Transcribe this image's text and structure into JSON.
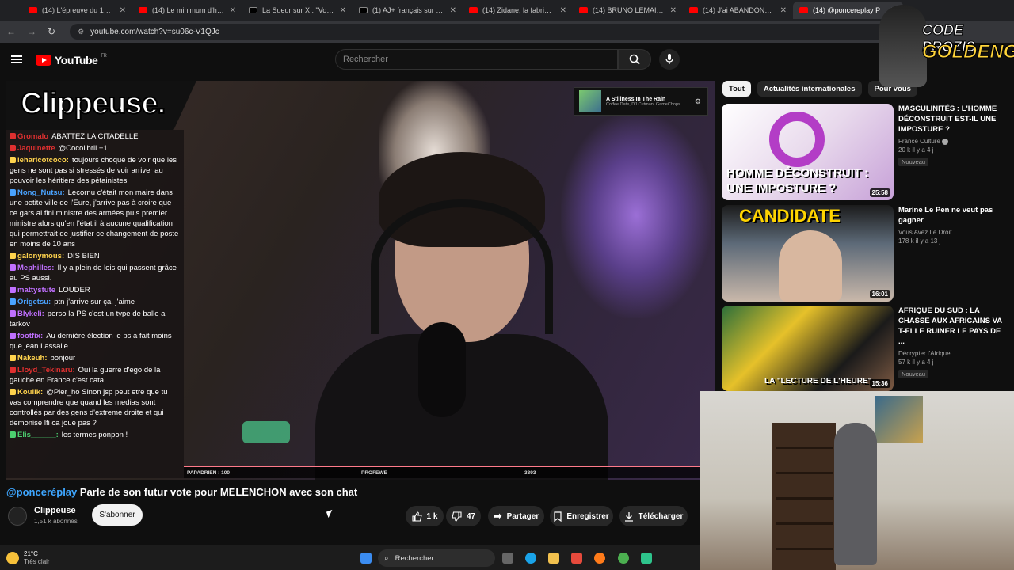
{
  "browser": {
    "tabs": [
      {
        "label": "(14) L'épreuve du 100 mi",
        "type": "youtube"
      },
      {
        "label": "(14) Le minimum d'heure",
        "type": "youtube"
      },
      {
        "label": "La Sueur sur X : \"Vous pla",
        "type": "x"
      },
      {
        "label": "(1) AJ+ français sur X : \"C",
        "type": "x"
      },
      {
        "label": "(14) Zidane, la fabrique d",
        "type": "youtube"
      },
      {
        "label": "(14) BRUNO LEMAIRE HU",
        "type": "youtube"
      },
      {
        "label": "(14) J'ai ABANDONNÉ ce",
        "type": "youtube"
      },
      {
        "label": "(14) @poncereplay P",
        "type": "youtube",
        "active": true
      }
    ],
    "url": "youtube.com/watch?v=su06c-V1QJc"
  },
  "youtube": {
    "logo_text": "YouTube",
    "logo_region": "FR",
    "search_placeholder": "Rechercher"
  },
  "stream": {
    "overlay_title": "Clippeuse.",
    "music": {
      "title": "A Stillness In The Rain",
      "artist": "Coffee Date, DJ Cutman, GameChops"
    },
    "bottom_bar": [
      "PAPADRIEN : 100",
      "PROFEWE",
      "3393"
    ],
    "chat": [
      {
        "user": "Gromalo",
        "color": "#e03030",
        "text": "ABATTEZ LA CITADELLE"
      },
      {
        "user": "Jaquinette",
        "color": "#e03030",
        "text": "@Cocolibrii +1"
      },
      {
        "user": "leharicotcoco:",
        "color": "#ffd34d",
        "text": "toujours choqué de voir que les gens ne sont pas si stressés de voir arriver au pouvoir les héritiers des pétainistes"
      },
      {
        "user": "Nong_Nutsu:",
        "color": "#4aa3ff",
        "text": "Lecornu c'était mon maire dans une petite ville de l'Eure, j'arrive pas à croire que ce gars ai fini ministre des armées puis premier ministre alors qu'en l'état il à aucune qualification qui permettrait de justifier ce changement de poste en moins de 10 ans"
      },
      {
        "user": "galonymous:",
        "color": "#ffd34d",
        "text": "DIS BIEN"
      },
      {
        "user": "Mephilles:",
        "color": "#c070ff",
        "text": "Il y a plein de lois qui passent grâce au PS aussi."
      },
      {
        "user": "mattystute",
        "color": "#c070ff",
        "text": "LOUDER"
      },
      {
        "user": "Origetsu:",
        "color": "#4aa3ff",
        "text": "ptn j'arrive sur ça, j'aime"
      },
      {
        "user": "Blykeli:",
        "color": "#c070ff",
        "text": "perso la PS c'est un type de balle a tarkov"
      },
      {
        "user": "footfix:",
        "color": "#c070ff",
        "text": "Au dernière élection le ps a fait moins que jean Lassalle"
      },
      {
        "user": "Nakeuh:",
        "color": "#ffd34d",
        "text": "bonjour"
      },
      {
        "user": "Lloyd_Tekinaru:",
        "color": "#e03030",
        "text": "Oui la guerre d'ego de la gauche en France c'est cata"
      },
      {
        "user": "Kouilk:",
        "color": "#ffd34d",
        "text": "@Pier_ho Sinon jsp peut etre que tu vas comprendre que quand les medias sont controllés par des gens d'extreme droite et qui demonise lfi ca joue pas ?"
      },
      {
        "user": "Elis______:",
        "color": "#4ccf6f",
        "text": "les termes ponpon !"
      }
    ]
  },
  "video": {
    "title_mention": "@ponceréplay",
    "title_rest": "Parle de son futur vote pour MELENCHON avec son chat",
    "channel_name": "Clippeuse",
    "channel_subs": "1,51 k abonnés",
    "subscribe_label": "S'abonner",
    "likes": "1 k",
    "dislikes": "47",
    "share_label": "Partager",
    "save_label": "Enregistrer",
    "download_label": "Télécharger"
  },
  "sidebar": {
    "chips": [
      "Tout",
      "Actualités internationales",
      "Pour vous"
    ],
    "videos": [
      {
        "title": "MASCULINITÉS : L'HOMME DÉCONSTRUIT EST-IL UNE IMPOSTURE ?",
        "channel": "France Culture",
        "meta": "20 k  il y a 4 j",
        "badge": "Nouveau",
        "duration": "25:58",
        "thumb_text": "HOMME DÉCONSTRUIT : UNE IMPOSTURE ?"
      },
      {
        "title": "Marine Le Pen ne veut pas gagner",
        "channel": "Vous Avez Le Droit",
        "meta": "178 k  il y a 13 j",
        "badge": "",
        "duration": "16:01",
        "thumb_text": "CANDIDATE"
      },
      {
        "title": "AFRIQUE DU SUD : LA CHASSE AUX AFRICAINS VA T-ELLE RUINER LE PAYS DE ...",
        "channel": "Décrypter l'Afrique",
        "meta": "57 k  il y a 4 j",
        "badge": "Nouveau",
        "duration": "15:36",
        "thumb_text": "LA \"LECTURE DE L'HEURE\""
      }
    ]
  },
  "overlay": {
    "line1": "CODE PROZIS",
    "line2": "GOLDENG"
  },
  "taskbar": {
    "temperature": "21°C",
    "weather": "Très clair",
    "search_label": "Rechercher"
  },
  "colors": {
    "accent": "#ff0000",
    "link": "#3ea6ff",
    "background": "#0f0f0f"
  }
}
